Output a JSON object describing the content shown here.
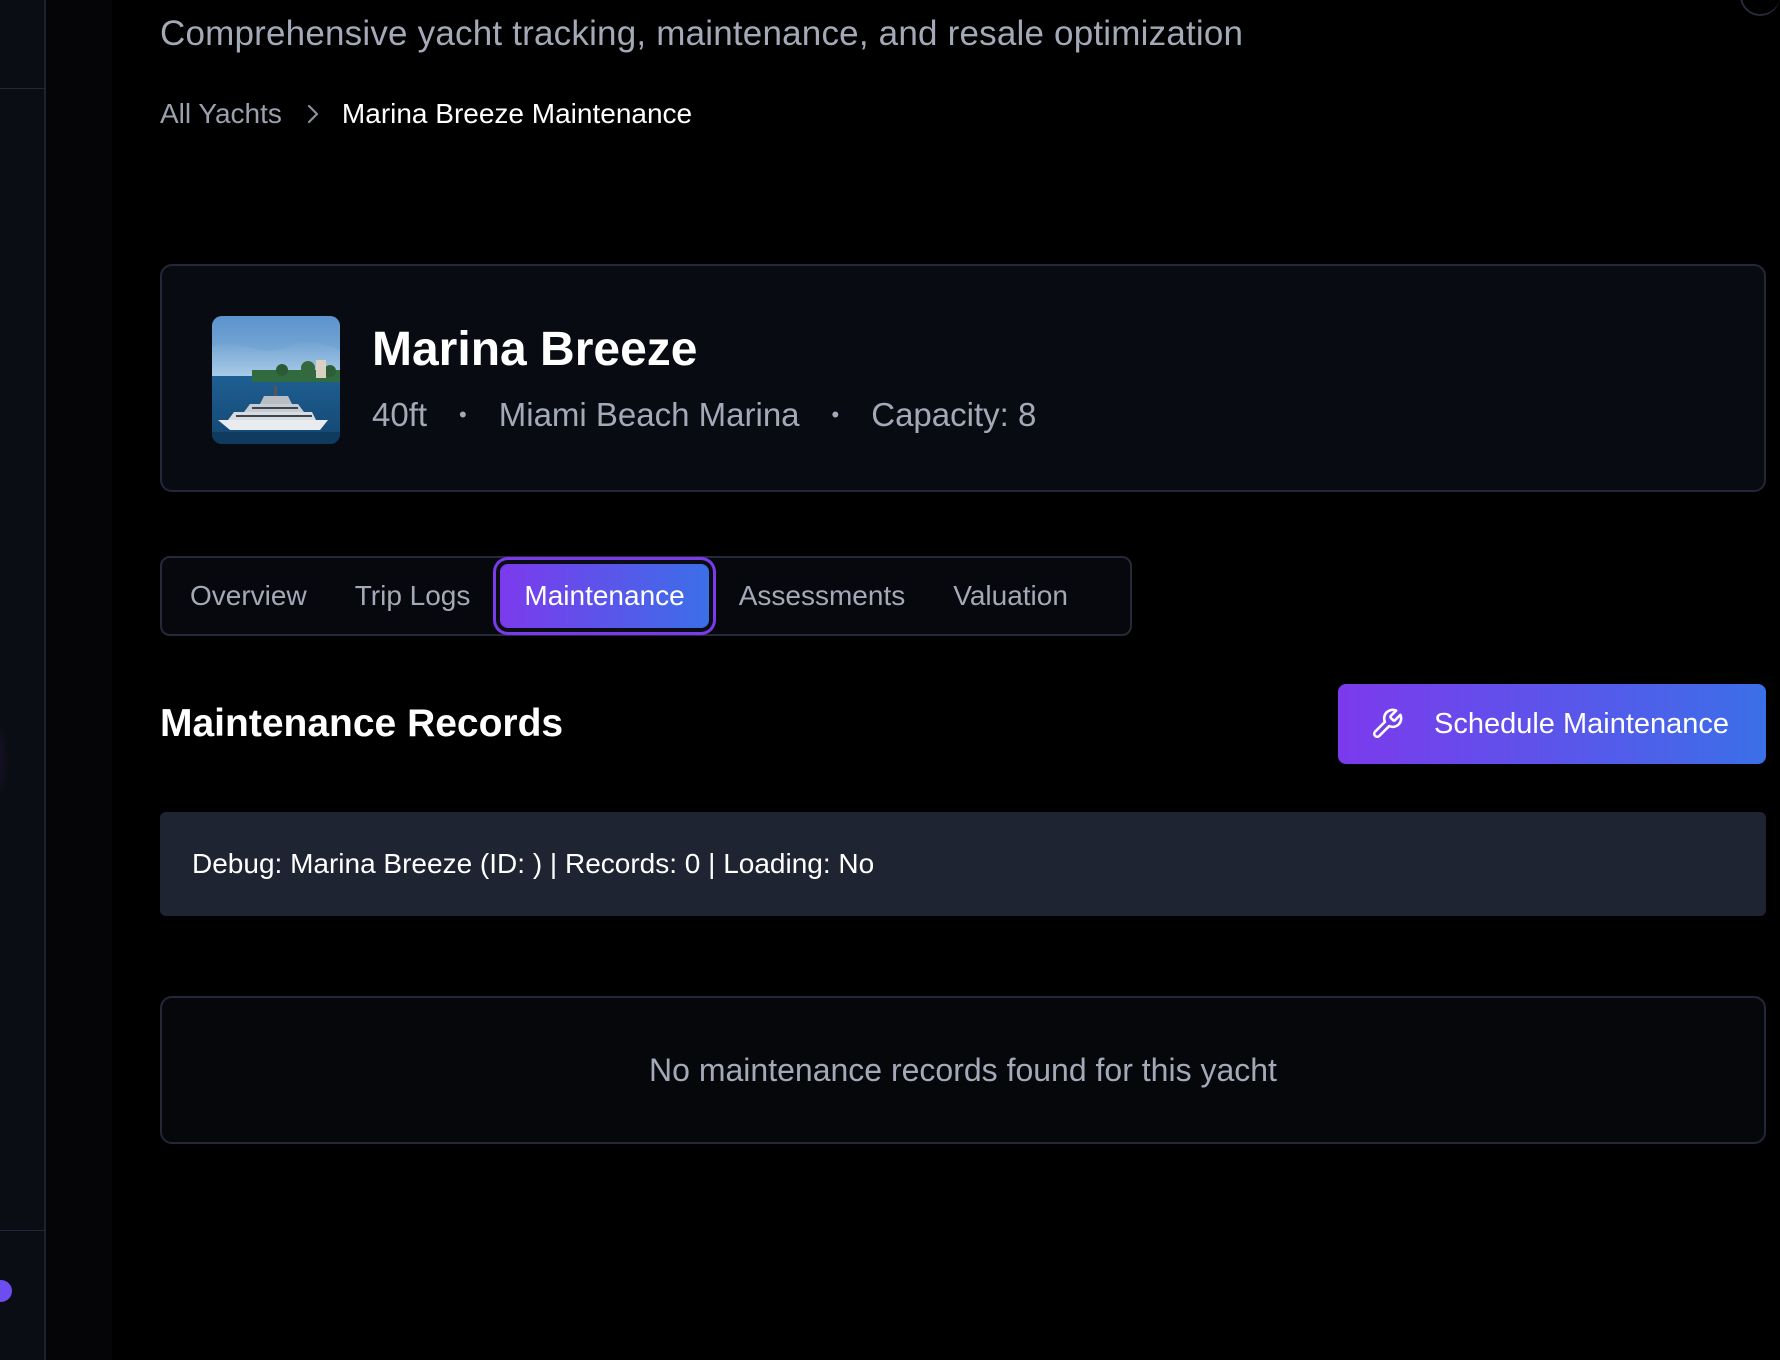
{
  "header": {
    "subtitle": "Comprehensive yacht tracking, maintenance, and resale optimization"
  },
  "breadcrumb": {
    "items": [
      {
        "label": "All Yachts"
      },
      {
        "label": "Marina Breeze Maintenance"
      }
    ]
  },
  "yacht": {
    "name": "Marina Breeze",
    "length": "40ft",
    "location": "Miami Beach Marina",
    "capacity": "Capacity: 8",
    "separator": "•"
  },
  "tabs": [
    {
      "label": "Overview",
      "active": false
    },
    {
      "label": "Trip Logs",
      "active": false
    },
    {
      "label": "Maintenance",
      "active": true
    },
    {
      "label": "Assessments",
      "active": false
    },
    {
      "label": "Valuation",
      "active": false
    }
  ],
  "section": {
    "title": "Maintenance Records",
    "schedule_button_label": "Schedule Maintenance",
    "schedule_button_icon": "wrench-icon"
  },
  "debug": {
    "text": "Debug: Marina Breeze (ID: ) | Records: 0 | Loading: No"
  },
  "empty_state": {
    "message": "No maintenance records found for this yacht"
  },
  "colors": {
    "accent_start": "#7c3aed",
    "accent_end": "#3b6fe8",
    "background": "#000000",
    "card": "#090b12"
  }
}
